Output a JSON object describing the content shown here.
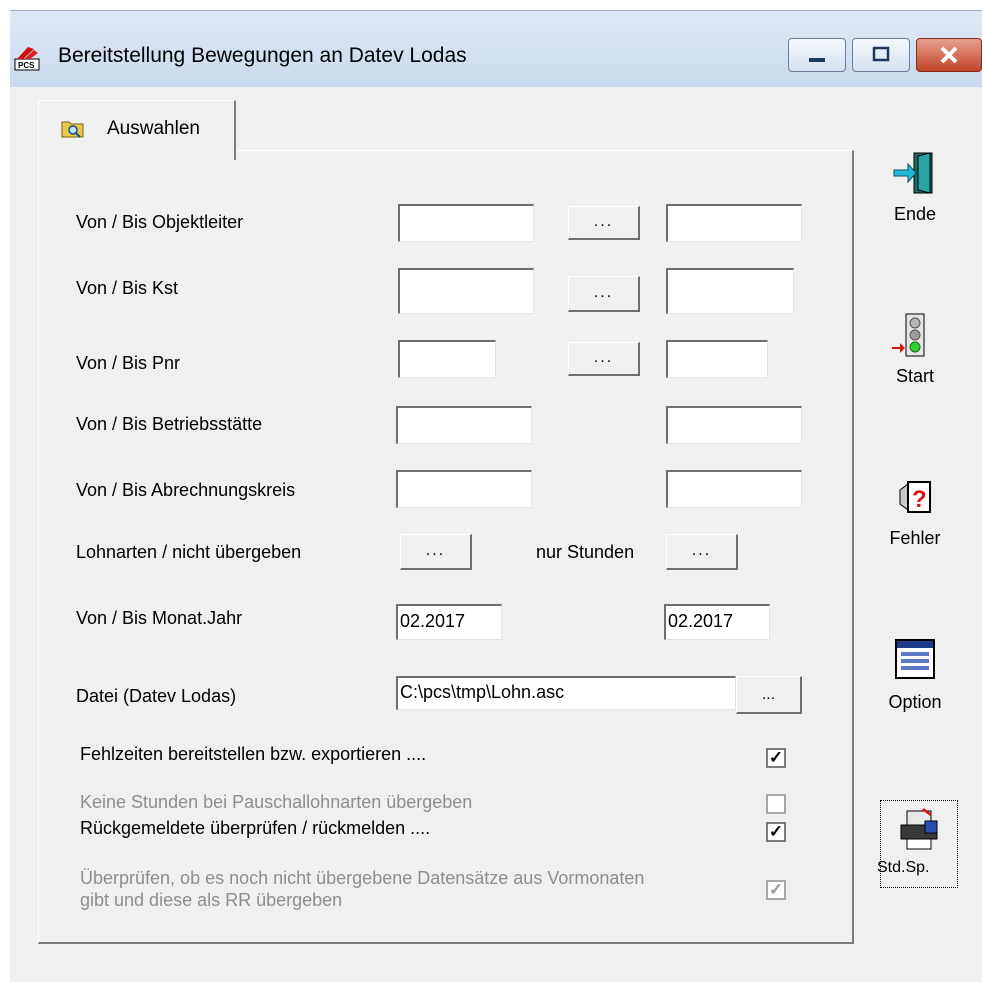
{
  "window": {
    "title": "Bereitstellung Bewegungen an Datev Lodas",
    "controls": {
      "minimize_icon": "minimize-icon",
      "maximize_icon": "maximize-icon",
      "close_icon": "close-icon"
    }
  },
  "tab": {
    "label": "Auswahlen"
  },
  "form": {
    "objektleiter": {
      "label": "Von / Bis Objektleiter",
      "from": "",
      "to": "",
      "button": "..."
    },
    "kst": {
      "label": "Von / Bis Kst",
      "from": "",
      "to": "",
      "button": "..."
    },
    "pnr": {
      "label": "Von / Bis Pnr",
      "from": "",
      "to": "",
      "button": "..."
    },
    "betriebsstaette": {
      "label": "Von / Bis Betriebsstätte",
      "from": "",
      "to": ""
    },
    "abrechnungskreis": {
      "label": "Von / Bis Abrechnungskreis",
      "from": "",
      "to": ""
    },
    "lohnarten": {
      "label": "Lohnarten / nicht übergeben",
      "button": "...",
      "nur_stunden_label": "nur Stunden",
      "nur_stunden_button": "..."
    },
    "monat_jahr": {
      "label": "Von / Bis Monat.Jahr",
      "from": "02.2017",
      "to": "02.2017"
    },
    "datei": {
      "label": "Datei (Datev Lodas)",
      "value": "C:\\pcs\\tmp\\Lohn.asc",
      "button": "..."
    },
    "checkboxes": [
      {
        "label": "Fehlzeiten bereitstellen bzw. exportieren ....",
        "checked": true,
        "enabled": true,
        "mark": "✓"
      },
      {
        "label": "Keine Stunden bei Pauschallohnarten übergeben",
        "checked": false,
        "enabled": false,
        "mark": ""
      },
      {
        "label": "Rückgemeldete überprüfen / rückmelden ....",
        "checked": true,
        "enabled": true,
        "mark": "✓"
      },
      {
        "label_line1": "Überprüfen, ob es noch nicht übergebene Datensätze aus Vormonaten",
        "label_line2": "gibt und diese als RR übergeben",
        "checked": true,
        "enabled": false,
        "mark": "✓"
      }
    ]
  },
  "sidebar": {
    "ende": {
      "label": "Ende",
      "icon": "exit-door-icon"
    },
    "start": {
      "label": "Start",
      "icon": "traffic-light-icon"
    },
    "fehler": {
      "label": "Fehler",
      "icon": "error-question-icon"
    },
    "option": {
      "label": "Option",
      "icon": "options-window-icon"
    },
    "stdsp": {
      "label": "Std.Sp.",
      "icon": "save-printer-icon"
    }
  },
  "colors": {
    "window_bg": "#f0f0f0",
    "titlebar": "#c9d9ec",
    "close_button": "#c1432a",
    "disabled_text": "#8e8e8e"
  }
}
